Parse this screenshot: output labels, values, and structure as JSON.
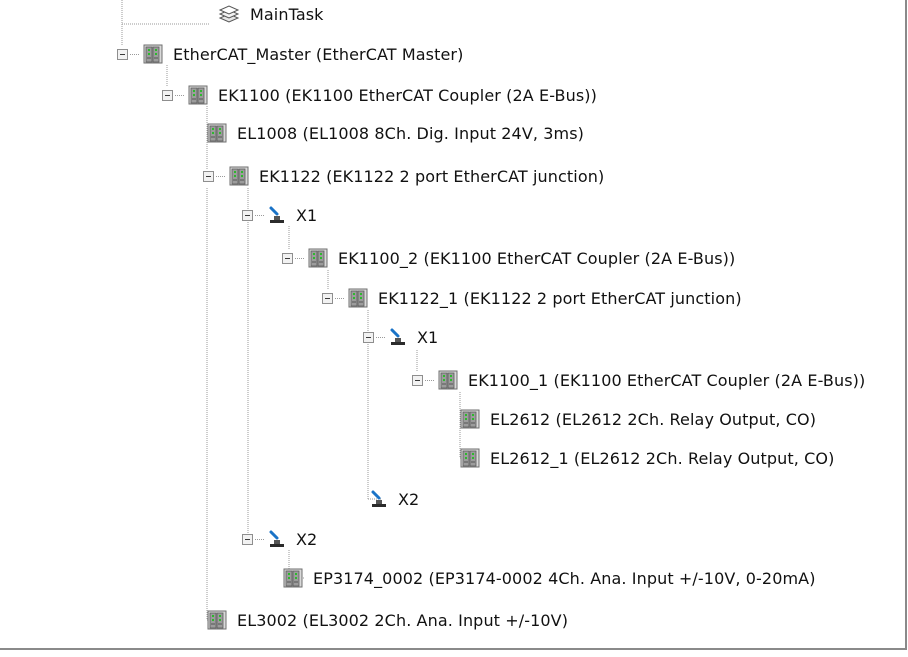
{
  "tree": {
    "items": [
      {
        "label": "MainTask",
        "icon": "task-icon",
        "expander": false
      },
      {
        "label": "EtherCAT_Master (EtherCAT Master)",
        "icon": "device-icon",
        "expander": true
      },
      {
        "label": "EK1100 (EK1100 EtherCAT Coupler (2A E-Bus))",
        "icon": "device-icon",
        "expander": true
      },
      {
        "label": "EL1008 (EL1008 8Ch. Dig. Input 24V, 3ms)",
        "icon": "device-icon",
        "expander": false
      },
      {
        "label": "EK1122 (EK1122 2 port EtherCAT junction)",
        "icon": "device-icon",
        "expander": true
      },
      {
        "label": "X1",
        "icon": "port-icon",
        "expander": true
      },
      {
        "label": "EK1100_2 (EK1100 EtherCAT Coupler (2A E-Bus))",
        "icon": "device-icon",
        "expander": true
      },
      {
        "label": "EK1122_1 (EK1122 2 port EtherCAT junction)",
        "icon": "device-icon",
        "expander": true
      },
      {
        "label": "X1",
        "icon": "port-icon",
        "expander": true
      },
      {
        "label": "EK1100_1 (EK1100 EtherCAT Coupler (2A E-Bus))",
        "icon": "device-icon",
        "expander": true
      },
      {
        "label": "EL2612 (EL2612 2Ch. Relay Output, CO)",
        "icon": "device-icon",
        "expander": false
      },
      {
        "label": "EL2612_1 (EL2612 2Ch. Relay Output, CO)",
        "icon": "device-icon",
        "expander": false
      },
      {
        "label": "X2",
        "icon": "port-icon",
        "expander": false
      },
      {
        "label": "X2",
        "icon": "port-icon",
        "expander": true
      },
      {
        "label": "EP3174_0002 (EP3174-0002 4Ch. Ana. Input +/-10V, 0-20mA)",
        "icon": "device-icon",
        "expander": false
      },
      {
        "label": "EL3002 (EL3002 2Ch. Ana. Input +/-10V)",
        "icon": "device-icon",
        "expander": false
      }
    ]
  },
  "colors": {
    "tree_line": "#9a9a9a",
    "device_body": "#9c9c9c",
    "device_led": "#2db82d",
    "port_blue": "#1a73c7",
    "text": "#111111"
  }
}
